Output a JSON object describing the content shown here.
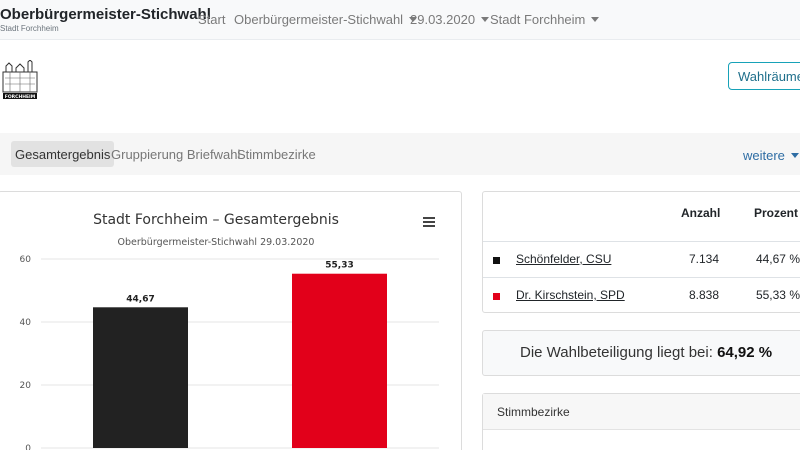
{
  "navbar": {
    "brand_title": "Oberbürgermeister-Stichwahl",
    "brand_subtitle": "Stadt Forchheim",
    "items": [
      {
        "label": "Start"
      },
      {
        "label": "Oberbürgermeister-Stichwahl"
      },
      {
        "label": "29.03.2020"
      },
      {
        "label": "Stadt Forchheim"
      }
    ]
  },
  "logo": {
    "text": "FORCHHEIM"
  },
  "actions": {
    "wahlraeume_label": "Wahlräume"
  },
  "tabs": [
    {
      "label": "Gesamtergebnis",
      "active": true
    },
    {
      "label": "Gruppierung Briefwahl",
      "active": false
    },
    {
      "label": "Stimmbezirke",
      "active": false
    }
  ],
  "weitere_label": "weitere",
  "chart_data": {
    "type": "bar",
    "title": "Stadt Forchheim – Gesamtergebnis",
    "subtitle": "Oberbürgermeister-Stichwahl 29.03.2020",
    "categories": [
      "Schönfelder, CSU",
      "Dr. Kirschstein, SPD"
    ],
    "values": [
      44.67,
      55.33
    ],
    "data_labels": [
      "44,67",
      "55,33"
    ],
    "colors": [
      "#222222",
      "#e2001a"
    ],
    "ylim": [
      0,
      60
    ],
    "yticks": [
      0,
      20,
      40,
      60
    ],
    "grid": true,
    "legend": "none"
  },
  "results": {
    "headers": {
      "anzahl": "Anzahl",
      "prozent": "Prozent"
    },
    "rows": [
      {
        "name": "Schönfelder, CSU",
        "anzahl": "7.134",
        "prozent": "44,67 %",
        "color": "#111111"
      },
      {
        "name": "Dr. Kirschstein, SPD",
        "anzahl": "8.838",
        "prozent": "55,33 %",
        "color": "#e2001a"
      }
    ]
  },
  "turnout": {
    "text": "Die Wahlbeteiligung liegt bei:",
    "value": "64,92 %"
  },
  "stimmbezirke": {
    "title": "Stimmbezirke"
  }
}
